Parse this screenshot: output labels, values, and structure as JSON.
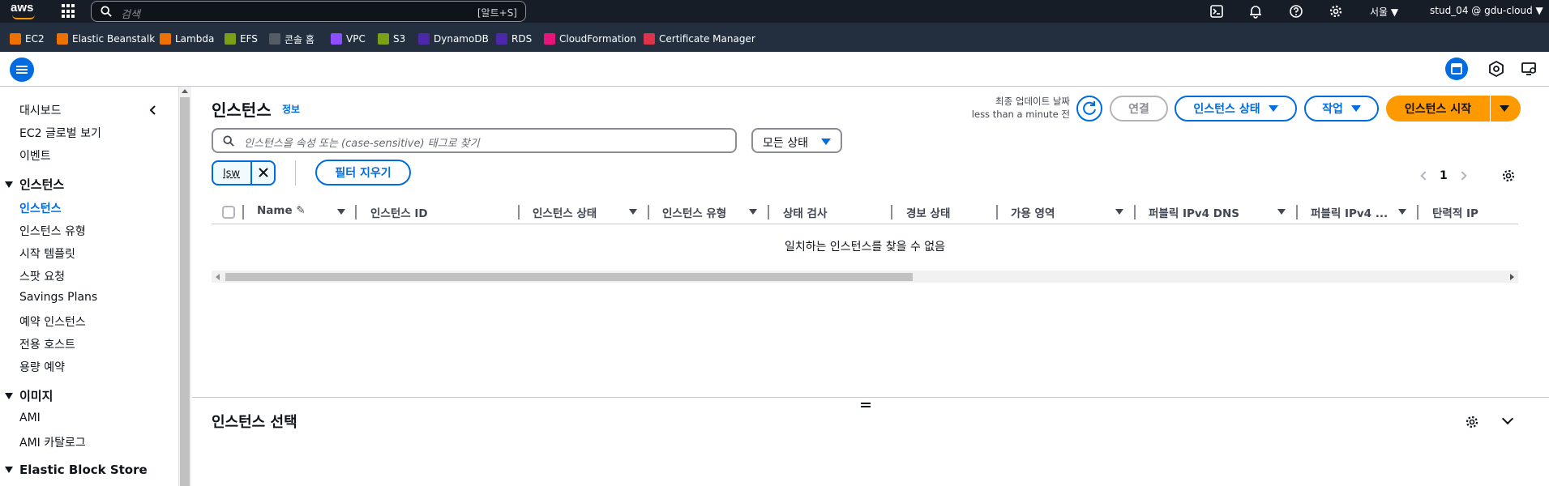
{
  "topbar": {
    "logo_text": "aws",
    "search_placeholder": "검색",
    "search_shortcut": "[알트+S]",
    "region": "서울 ▼",
    "account": "stud_04 @ gdu-cloud ▼"
  },
  "favorites": [
    {
      "label": "EC2",
      "color": "#ed7100"
    },
    {
      "label": "Elastic Beanstalk",
      "color": "#ed7100"
    },
    {
      "label": "Lambda",
      "color": "#ed7100"
    },
    {
      "label": "EFS",
      "color": "#7aa116"
    },
    {
      "label": "콘솔 홈",
      "color": "#545b64"
    },
    {
      "label": "VPC",
      "color": "#8c4fff"
    },
    {
      "label": "S3",
      "color": "#7aa116"
    },
    {
      "label": "DynamoDB",
      "color": "#4d27aa"
    },
    {
      "label": "RDS",
      "color": "#4d27aa"
    },
    {
      "label": "CloudFormation",
      "color": "#e7157b"
    },
    {
      "label": "Certificate Manager",
      "color": "#dd344c"
    }
  ],
  "sidebar": {
    "items_top": [
      "대시보드",
      "EC2 글로벌 보기",
      "이벤트"
    ],
    "section_instances": "인스턴스",
    "instances_items": [
      "인스턴스",
      "인스턴스 유형",
      "시작 템플릿",
      "스팟 요청",
      "Savings Plans",
      "예약 인스턴스",
      "전용 호스트",
      "용량 예약"
    ],
    "section_images": "이미지",
    "images_items": [
      "AMI",
      "AMI 카탈로그"
    ],
    "section_ebs": "Elastic Block Store"
  },
  "main": {
    "title": "인스턴스",
    "info": "정보",
    "last_update_label": "최종 업데이트 날짜",
    "last_update_value": "less than a minute 전",
    "connect_label": "연결",
    "state_label": "인스턴스 상태",
    "actions_label": "작업",
    "launch_label": "인스턴스 시작",
    "filter_placeholder": "인스턴스을 속성 또는 (case-sensitive) 태그로 찾기",
    "state_filter": "모든 상태",
    "token": "lsw",
    "clear_filters": "필터 지우기",
    "page": "1",
    "columns": [
      "Name",
      "인스턴스 ID",
      "인스턴스 상태",
      "인스턴스 유형",
      "상태 검사",
      "경보 상태",
      "가용 영역",
      "퍼블릭 IPv4 DNS",
      "퍼블릭 IPv4 ...",
      "탄력적 IP"
    ],
    "empty_message": "일치하는 인스턴스를 찾을 수 없음",
    "split_title": "인스턴스 선택"
  },
  "colors": {
    "accent": "#006ce0",
    "primary_button": "#ff9900",
    "topbar": "#161d26",
    "favbar": "#232f3e"
  }
}
